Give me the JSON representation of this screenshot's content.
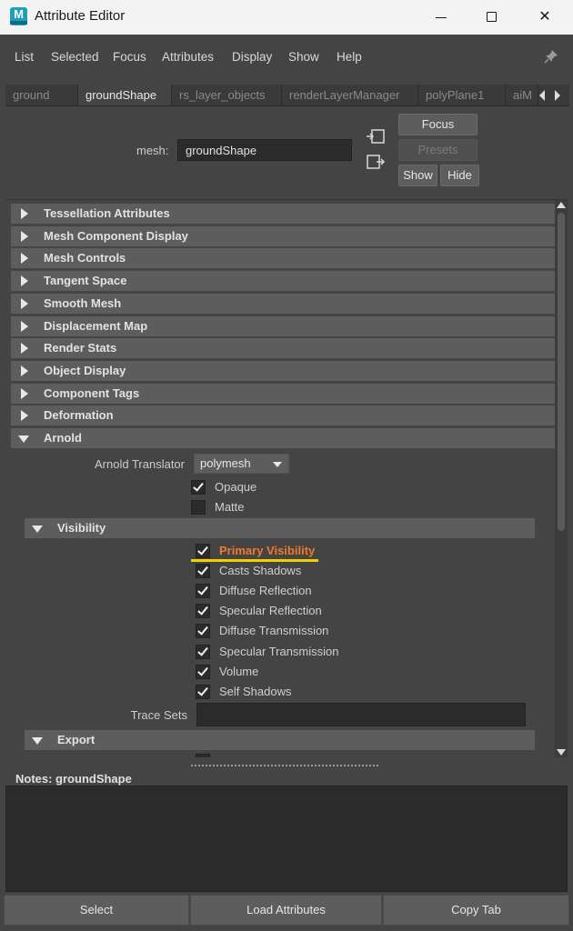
{
  "window": {
    "title": "Attribute Editor",
    "app_icon_letter": "M",
    "minimize_glyph": "",
    "close_glyph": "✕"
  },
  "menu": {
    "items": [
      "List",
      "Selected",
      "Focus",
      "Attributes",
      "Display",
      "Show",
      "Help"
    ],
    "pin_icon": "pin-icon"
  },
  "tabs": [
    "ground",
    "groundShape",
    "rs_layer_objects",
    "renderLayerManager",
    "polyPlane1",
    "aiM"
  ],
  "active_tab": "groundShape",
  "header": {
    "mesh_label": "mesh:",
    "mesh_value": "groundShape",
    "focus_label": "Focus",
    "presets_label": "Presets",
    "show_label": "Show",
    "hide_label": "Hide"
  },
  "sections": [
    "Tessellation Attributes",
    "Mesh Component Display",
    "Mesh Controls",
    "Tangent Space",
    "Smooth Mesh",
    "Displacement Map",
    "Render Stats",
    "Object Display",
    "Component Tags",
    "Deformation",
    "Arnold"
  ],
  "arnold": {
    "translator_label": "Arnold Translator",
    "translator_value": "polymesh",
    "opaque_label": "Opaque",
    "opaque_checked": true,
    "matte_label": "Matte",
    "matte_checked": false,
    "visibility_header": "Visibility",
    "visibility_items": [
      {
        "label": "Primary Visibility",
        "checked": true,
        "highlighted": true
      },
      {
        "label": "Casts Shadows",
        "checked": true
      },
      {
        "label": "Diffuse Reflection",
        "checked": true
      },
      {
        "label": "Specular Reflection",
        "checked": true
      },
      {
        "label": "Diffuse Transmission",
        "checked": true
      },
      {
        "label": "Specular Transmission",
        "checked": true
      },
      {
        "label": "Volume",
        "checked": true
      },
      {
        "label": "Self Shadows",
        "checked": true
      }
    ],
    "trace_sets_label": "Trace Sets",
    "trace_sets_value": "",
    "export_header": "Export"
  },
  "notes": {
    "label": "Notes:  groundShape",
    "value": ""
  },
  "bottom_buttons": {
    "select": "Select",
    "load_attributes": "Load Attributes",
    "copy_tab": "Copy Tab"
  },
  "colors": {
    "highlight_text": "#f07a2a",
    "highlight_underline": "#f0d000",
    "panel_bg": "#444444",
    "header_bg": "#5d5d5d",
    "field_bg": "#2b2b2b"
  }
}
